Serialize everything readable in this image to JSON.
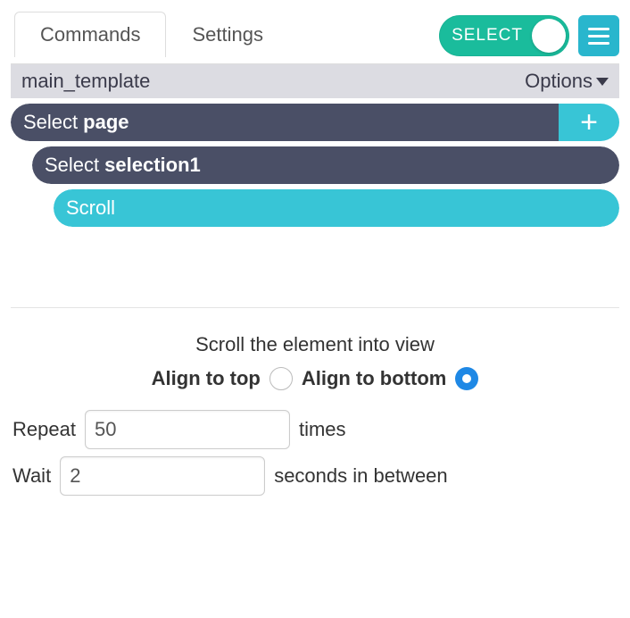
{
  "tabs": {
    "commands": "Commands",
    "settings": "Settings"
  },
  "top": {
    "toggleLabel": "SELECT"
  },
  "template": {
    "name": "main_template",
    "optionsLabel": "Options"
  },
  "commands": {
    "row1_prefix": "Select",
    "row1_bold": "page",
    "row2_prefix": "Select",
    "row2_bold": "selection1",
    "row3_label": "Scroll"
  },
  "config": {
    "heading": "Scroll the element into view",
    "alignTop": "Align to top",
    "alignBottom": "Align to bottom",
    "repeatLabel": "Repeat",
    "repeatValue": "50",
    "repeatSuffix": "times",
    "waitLabel": "Wait",
    "waitValue": "2",
    "waitSuffix": "seconds in between"
  }
}
